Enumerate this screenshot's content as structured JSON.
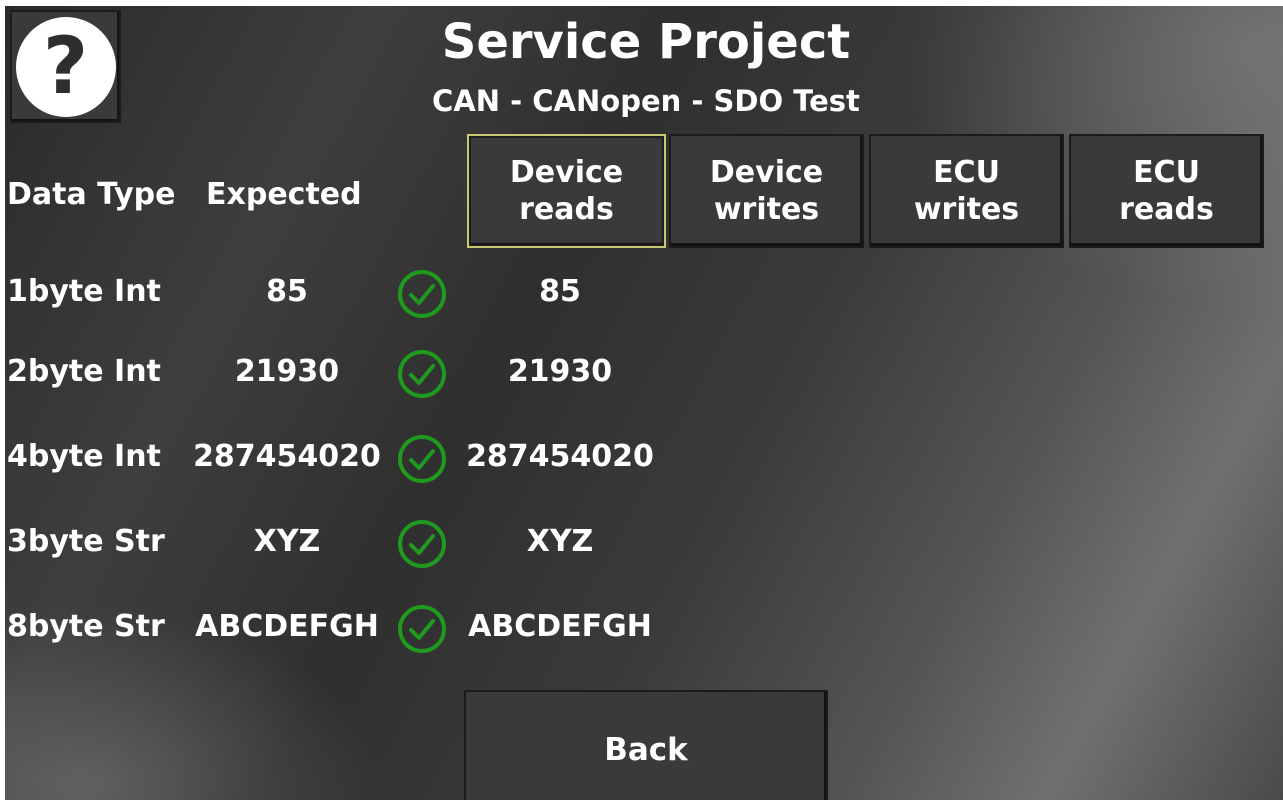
{
  "header": {
    "title": "Service Project",
    "subtitle": "CAN - CANopen - SDO Test",
    "help_icon": "?"
  },
  "tabs": [
    {
      "label": "Device\nreads",
      "active": true
    },
    {
      "label": "Device\nwrites",
      "active": false
    },
    {
      "label": "ECU\nwrites",
      "active": false
    },
    {
      "label": "ECU\nreads",
      "active": false
    }
  ],
  "table": {
    "headers": {
      "data_type": "Data Type",
      "expected": "Expected"
    },
    "rows": [
      {
        "type": "1byte Int",
        "expected": "85",
        "status": "check-icon",
        "actual": "85"
      },
      {
        "type": "2byte Int",
        "expected": "21930",
        "status": "check-icon",
        "actual": "21930"
      },
      {
        "type": "4byte Int",
        "expected": "287454020",
        "status": "check-icon",
        "actual": "287454020"
      },
      {
        "type": "3byte Str",
        "expected": "XYZ",
        "status": "check-icon",
        "actual": "XYZ"
      },
      {
        "type": "8byte Str",
        "expected": "ABCDEFGH",
        "status": "check-icon",
        "actual": "ABCDEFGH"
      }
    ]
  },
  "footer": {
    "back_label": "Back"
  },
  "colors": {
    "check": "#1f9a1f",
    "active_border": "#c8c870"
  }
}
